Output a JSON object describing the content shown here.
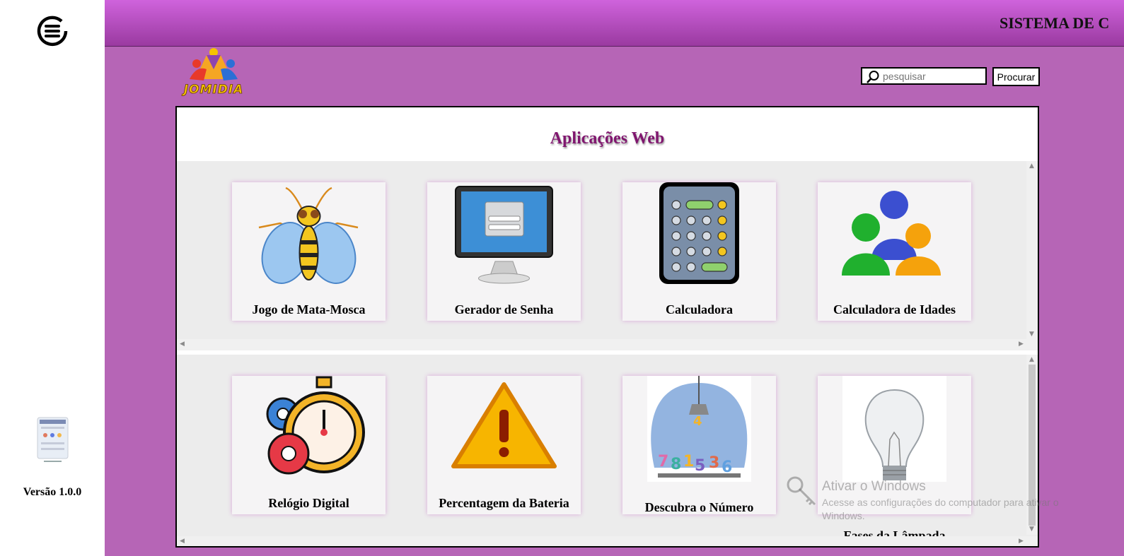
{
  "topbar": {
    "title": "SISTEMA DE C"
  },
  "sidebar": {
    "version": "Versão 1.0.0",
    "menu_icon": "hamburger-menu-icon"
  },
  "search": {
    "placeholder": "pesquisar",
    "button_label": "Procurar"
  },
  "main": {
    "title": "Aplicações Web",
    "apps_row1": [
      {
        "label": "Jogo de Mata-Mosca",
        "icon": "bee-icon"
      },
      {
        "label": "Gerador de Senha",
        "icon": "login-monitor-icon"
      },
      {
        "label": "Calculadora",
        "icon": "calculator-icon"
      },
      {
        "label": "Calculadora de Idades",
        "icon": "people-icon"
      }
    ],
    "apps_row2": [
      {
        "label": "Relógio Digital",
        "icon": "stopwatch-gears-icon"
      },
      {
        "label": "Percentagem da Bateria",
        "icon": "warning-icon"
      },
      {
        "label": "Descubra o Número",
        "icon": "claw-machine-icon"
      },
      {
        "label": "Fases da Lâmpada",
        "icon": "lightbulb-icon"
      }
    ]
  },
  "watermark": {
    "title": "Ativar o Windows",
    "subtitle": "Acesse as configurações do computador para ativar o Windows."
  },
  "colors": {
    "topbar": "#cf63dc",
    "background": "#b665b6",
    "title": "#80166f"
  }
}
